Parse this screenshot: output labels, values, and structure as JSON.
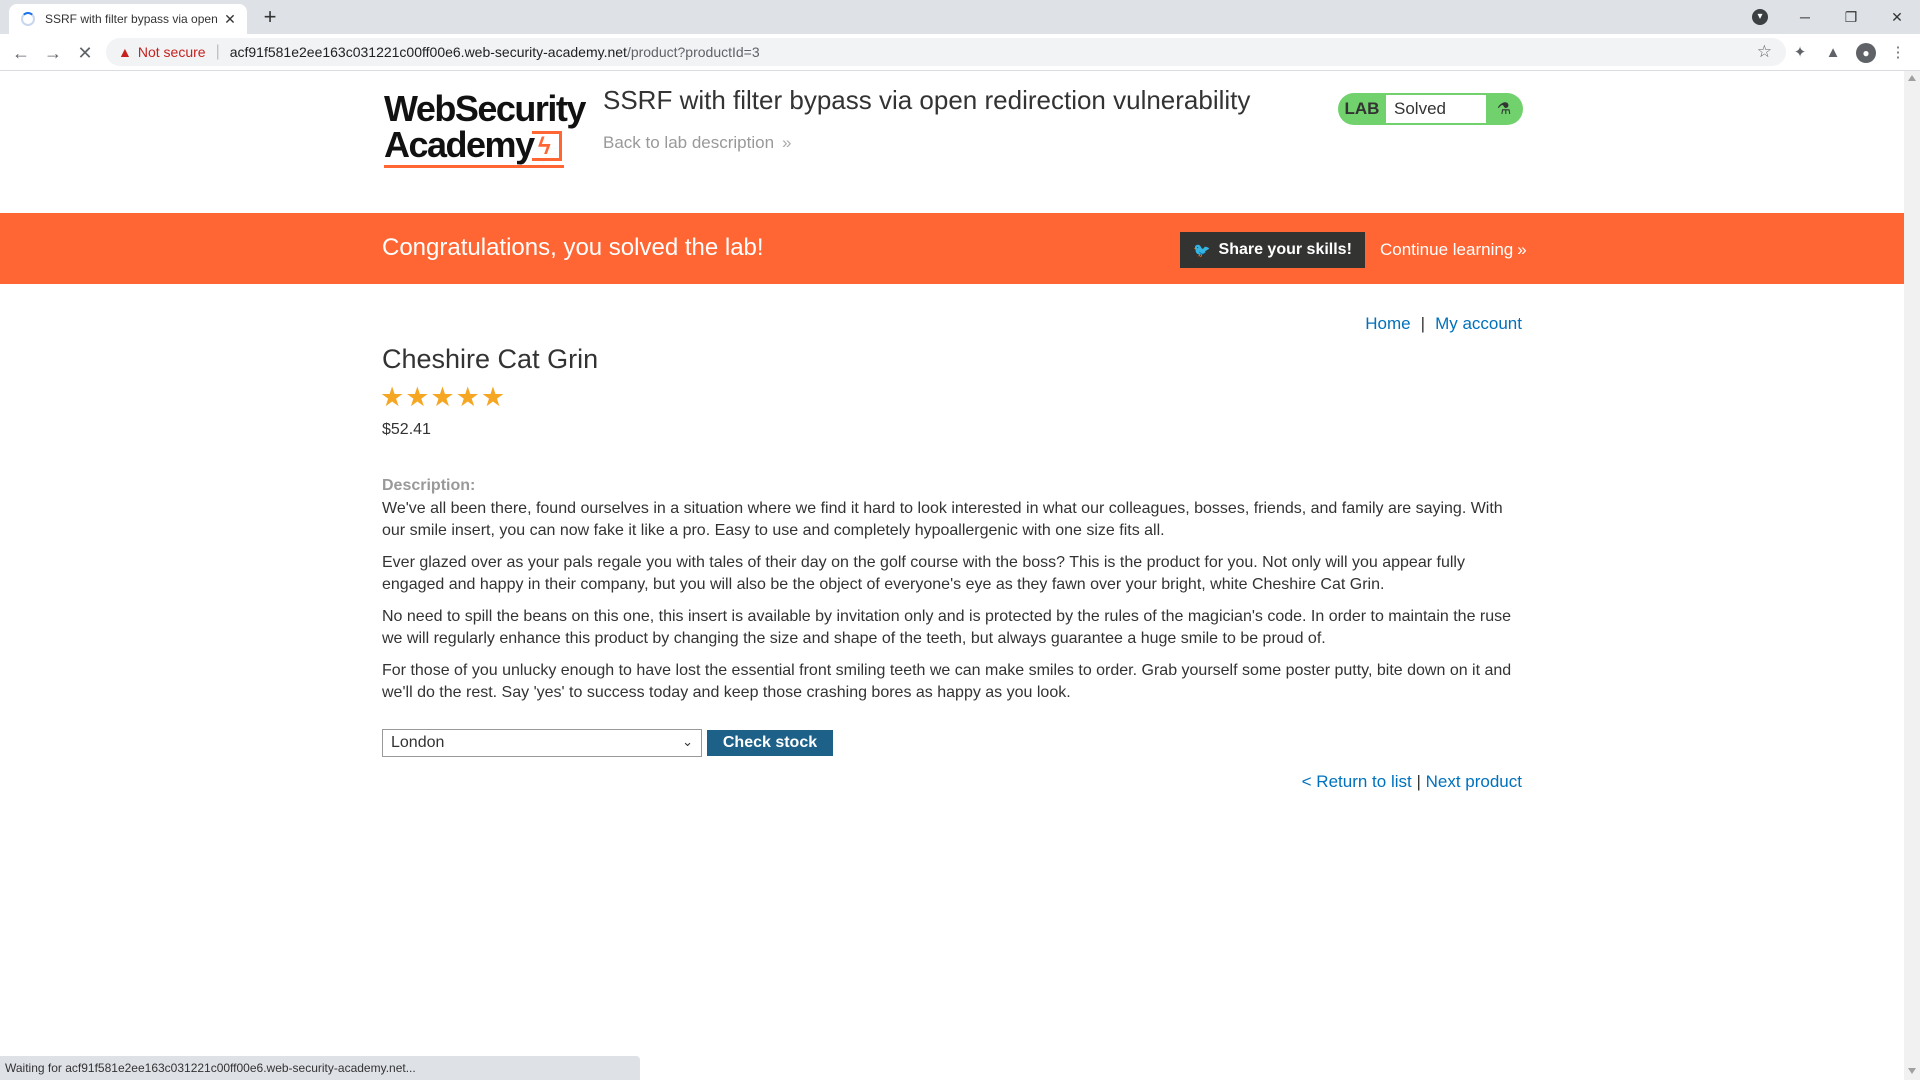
{
  "browser": {
    "tab_title": "SSRF with filter bypass via open r",
    "tab_close": "✕",
    "new_tab": "+",
    "not_secure": "Not secure",
    "url_host": "acf91f581e2ee163c031221c00ff00e6.web-security-academy.net",
    "url_path": "/product?productId=3",
    "status_text": "Waiting for acf91f581e2ee163c031221c00ff00e6.web-security-academy.net..."
  },
  "header": {
    "logo_line1": "WebSecurity",
    "logo_line2": "Academy",
    "lab_title": "SSRF with filter bypass via open redirection vulnerability",
    "back_link": "Back to lab description",
    "lab_tag": "LAB",
    "lab_state": "Solved"
  },
  "banner": {
    "message": "Congratulations, you solved the lab!",
    "share_label": "Share your skills!",
    "continue_label": "Continue learning"
  },
  "nav": {
    "home": "Home",
    "separator": "|",
    "my_account": "My account"
  },
  "product": {
    "name": "Cheshire Cat Grin",
    "rating_stars": 5,
    "stars_text": "★★★★★",
    "price": "$52.41",
    "description_label": "Description:",
    "paragraphs": [
      "We've all been there, found ourselves in a situation where we find it hard to look interested in what our colleagues, bosses, friends, and family are saying. With our smile insert, you can now fake it like a pro. Easy to use and completely hypoallergenic with one size fits all.",
      "Ever glazed over as your pals regale you with tales of their day on the golf course with the boss? This is the product for you. Not only will you appear fully engaged and happy in their company, but you will also be the object of everyone's eye as they fawn over your bright, white Cheshire Cat Grin.",
      "No need to spill the beans on this one, this insert is available by invitation only and is protected by the rules of the magician's code. In order to maintain the ruse we will regularly enhance this product by changing the size and shape of the teeth, but always guarantee a huge smile to be proud of.",
      "For those of you unlucky enough to have lost the essential front smiling teeth we can make smiles to order. Grab yourself some poster putty, bite down on it and we'll do the rest. Say 'yes' to success today and keep those crashing bores as happy as you look."
    ]
  },
  "stock": {
    "selected_store": "London",
    "check_label": "Check stock"
  },
  "footer_nav": {
    "return_label": "< Return to list",
    "separator": "|",
    "next_label": "Next product"
  },
  "colors": {
    "brand_orange": "#ff6633",
    "lab_green": "#70d16d",
    "link_blue": "#0071bc",
    "button_blue": "#1d6088",
    "star_gold": "#f5a623"
  }
}
